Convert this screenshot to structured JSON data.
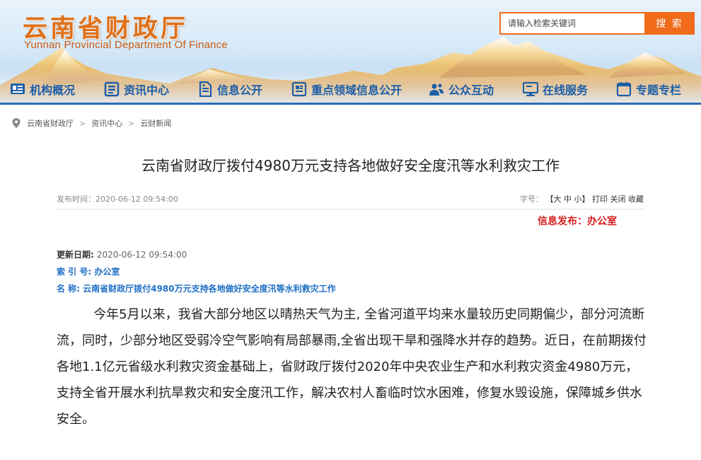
{
  "header": {
    "logo_cn": "云南省财政厅",
    "logo_en": "Yunnan Provincial Department Of Finance",
    "search": {
      "placeholder": "请输入检索关键词",
      "button_label": "搜 索"
    }
  },
  "nav": {
    "items": [
      {
        "label": "机构概况",
        "icon": "organization-icon"
      },
      {
        "label": "资讯中心",
        "icon": "news-icon"
      },
      {
        "label": "信息公开",
        "icon": "document-icon"
      },
      {
        "label": "重点领域信息公开",
        "icon": "key-area-icon"
      },
      {
        "label": "公众互动",
        "icon": "people-icon"
      },
      {
        "label": "在线服务",
        "icon": "monitor-icon"
      },
      {
        "label": "专题专栏",
        "icon": "column-icon"
      }
    ]
  },
  "breadcrumb": {
    "items": [
      "云南省财政厅",
      "资讯中心",
      "云财新闻"
    ],
    "separator": ">"
  },
  "article": {
    "title": "云南省财政厅拨付4980万元支持各地做好安全度汛等水利救灾工作",
    "publish_time_label": "发布时间：",
    "publish_time": "2020-06-12 09:54:00",
    "font_size_label": "字号：",
    "font_size_options": [
      "【大",
      "中",
      "小】"
    ],
    "print_label": "打印",
    "close_label": "关闭",
    "favorite_label": "收藏",
    "publisher": "信息发布：办公室",
    "update_label": "更新日期:",
    "update_value": "2020-06-12 09:54:00",
    "index_label": "索 引 号:",
    "index_value": "办公室",
    "name_label": "名 称:",
    "name_value": "云南省财政厅拨付4980万元支持各地做好安全度汛等水利救灾工作",
    "body": "今年5月以来，我省大部分地区以晴热天气为主, 全省河道平均来水量较历史同期偏少，部分河流断流，同时，少部分地区受弱冷空气影响有局部暴雨,全省出现干旱和强降水并存的趋势。近日，在前期拨付各地1.1亿元省级水利救灾资金基础上，省财政厅拨付2020年中央农业生产和水利救灾资金4980万元，支持全省开展水利抗旱救灾和安全度汛工作，解决农村人畜临时饮水困难，修复水毁设施，保障城乡供水安全。"
  },
  "colors": {
    "brand_orange": "#f06b1a",
    "nav_blue": "#1c5ea8",
    "publisher_red": "#d62020",
    "info_blue": "#1f6fc5"
  }
}
